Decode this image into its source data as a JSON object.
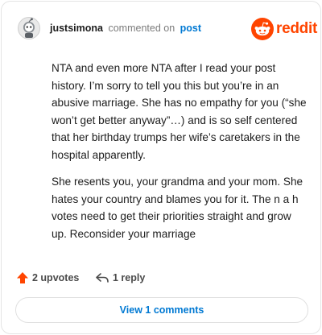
{
  "header": {
    "username": "justsimona",
    "action": "commented on",
    "post_link": "post",
    "brand": "reddit"
  },
  "comment": {
    "paragraphs": [
      "NTA and even more NTA after I read your post history. I’m sorry to tell you this but you’re in an abusive marriage. She has no empathy for you (“she won’t get better anyway”…) and is so self centered that her birthday trumps her wife’s caretakers in the hospital apparently.",
      "She resents you, your grandma and your mom. She hates your country and blames you for it. The n a h votes need to get their priorities straight and grow up. Reconsider your marriage"
    ]
  },
  "actions": {
    "upvotes": "2 upvotes",
    "replies": "1 reply",
    "upvote_icon": "upvote-arrow-icon",
    "reply_icon": "reply-arrow-icon"
  },
  "footer": {
    "view_comments": "View 1 comments"
  },
  "colors": {
    "brand_orange": "#ff4500",
    "upvote_orange": "#ff4500",
    "link_blue": "#0079d3"
  }
}
